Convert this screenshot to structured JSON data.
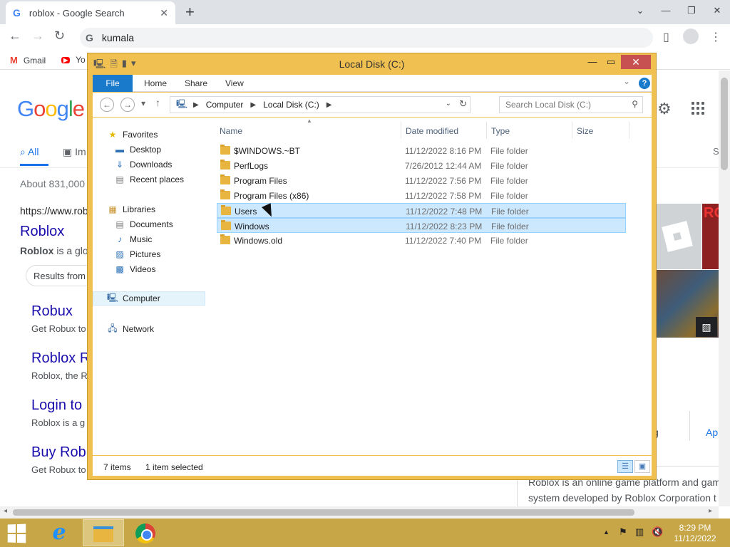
{
  "browser": {
    "tab_title": "roblox - Google Search",
    "tab_close": "✕",
    "new_tab": "+",
    "window_controls": [
      "⌄",
      "—",
      "❐",
      "✕"
    ],
    "omnibox_value": "kumala",
    "bookmarks": [
      {
        "label": "Gmail",
        "icon": "gmail-icon"
      },
      {
        "label": "Yo",
        "icon": "youtube-icon"
      }
    ]
  },
  "google": {
    "logo": [
      "G",
      "o",
      "o",
      "g",
      "l",
      "e"
    ],
    "tabs": [
      "All",
      "Im"
    ],
    "side_label": "S",
    "stats": "About 831,000",
    "result": {
      "url": "https://www.rob",
      "title": "Roblox",
      "snippet_bold": "Roblox",
      "snippet_rest": " is a glo"
    },
    "chip": "Results from r",
    "sublinks": [
      {
        "title": "Robux",
        "snippet": "Get Robux to"
      },
      {
        "title": "Roblox R",
        "snippet": "Roblox, the R"
      },
      {
        "title": "Login to",
        "snippet": "Roblox is a g"
      },
      {
        "title": "Buy Rob",
        "snippet": "Get Robux to"
      }
    ],
    "knowledge_panel": {
      "image_text": "ROBL",
      "text_a": "g",
      "text_b": "Ap",
      "desc_line1": "Roblox is an online game platform and gam",
      "desc_line2": "system developed by Roblox Corporation t"
    }
  },
  "explorer": {
    "title": "Local Disk (C:)",
    "ribbon_tabs": [
      "File",
      "Home",
      "Share",
      "View"
    ],
    "help": "?",
    "breadcrumb": [
      "Computer",
      "Local Disk (C:)"
    ],
    "search_placeholder": "Search Local Disk (C:)",
    "nav": {
      "favorites": {
        "label": "Favorites",
        "items": [
          "Desktop",
          "Downloads",
          "Recent places"
        ]
      },
      "libraries": {
        "label": "Libraries",
        "items": [
          "Documents",
          "Music",
          "Pictures",
          "Videos"
        ]
      },
      "computer": "Computer",
      "network": "Network"
    },
    "columns": [
      "Name",
      "Date modified",
      "Type",
      "Size"
    ],
    "files": [
      {
        "name": "$WINDOWS.~BT",
        "date": "11/12/2022 8:16 PM",
        "type": "File folder",
        "selected": false
      },
      {
        "name": "PerfLogs",
        "date": "7/26/2012 12:44 AM",
        "type": "File folder",
        "selected": false
      },
      {
        "name": "Program Files",
        "date": "11/12/2022 7:56 PM",
        "type": "File folder",
        "selected": false
      },
      {
        "name": "Program Files (x86)",
        "date": "11/12/2022 7:58 PM",
        "type": "File folder",
        "selected": false
      },
      {
        "name": "Users",
        "date": "11/12/2022 7:48 PM",
        "type": "File folder",
        "selected": true
      },
      {
        "name": "Windows",
        "date": "11/12/2022 8:23 PM",
        "type": "File folder",
        "selected": true
      },
      {
        "name": "Windows.old",
        "date": "11/12/2022 7:40 PM",
        "type": "File folder",
        "selected": false
      }
    ],
    "status_items": "7 items",
    "status_selected": "1 item selected"
  },
  "taskbar": {
    "time": "8:29 PM",
    "date": "11/12/2022"
  },
  "colors": {
    "explorer_frame": "#f0c050",
    "taskbar": "#c7a647",
    "selection": "#cce8ff",
    "link": "#1a0dab"
  }
}
